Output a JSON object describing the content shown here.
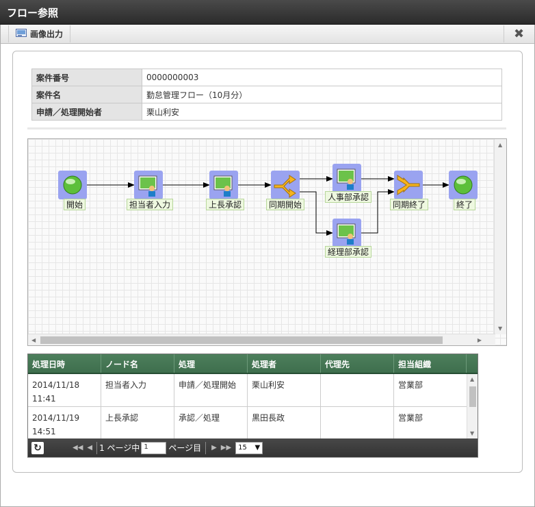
{
  "window": {
    "title": "フロー参照"
  },
  "toolbar": {
    "export_label": "画像出力",
    "close_glyph": "✖"
  },
  "info": {
    "rows": [
      {
        "label": "案件番号",
        "value": "0000000003"
      },
      {
        "label": "案件名",
        "value": "勤怠管理フロー（10月分）"
      },
      {
        "label": "申請／処理開始者",
        "value": "栗山利安"
      }
    ]
  },
  "flow": {
    "nodes": [
      {
        "id": "start",
        "label": "開始",
        "kind": "start-end"
      },
      {
        "id": "tanto",
        "label": "担当者入力",
        "kind": "user-task"
      },
      {
        "id": "jocho",
        "label": "上長承認",
        "kind": "user-task"
      },
      {
        "id": "sync_start",
        "label": "同期開始",
        "kind": "fork"
      },
      {
        "id": "jinji",
        "label": "人事部承認",
        "kind": "user-task"
      },
      {
        "id": "keiri",
        "label": "経理部承認",
        "kind": "user-task"
      },
      {
        "id": "sync_end",
        "label": "同期終了",
        "kind": "join"
      },
      {
        "id": "end",
        "label": "終了",
        "kind": "start-end"
      }
    ]
  },
  "history": {
    "columns": [
      "処理日時",
      "ノード名",
      "処理",
      "処理者",
      "代理先",
      "担当組織"
    ],
    "rows": [
      {
        "date": "2014/11/18",
        "time": "11:41",
        "node": "担当者入力",
        "action": "申請／処理開始",
        "user": "栗山利安",
        "proxy": "",
        "org": "営業部"
      },
      {
        "date": "2014/11/19",
        "time": "14:51",
        "node": "上長承認",
        "action": "承認／処理",
        "user": "黒田長政",
        "proxy": "",
        "org": "営業部"
      }
    ],
    "pager": {
      "total_pages_label": "1 ページ中",
      "current_page": "1",
      "page_suffix": "ページ目",
      "page_size": "15"
    }
  },
  "colors": {
    "header_green": "#3e6e4d",
    "node_bg": "#9aa3f0",
    "label_bg": "#eef8e0"
  }
}
